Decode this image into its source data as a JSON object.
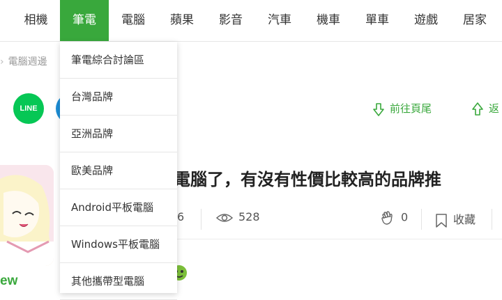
{
  "nav": {
    "items": [
      {
        "label": "相機"
      },
      {
        "label": "筆電"
      },
      {
        "label": "電腦"
      },
      {
        "label": "蘋果"
      },
      {
        "label": "影音"
      },
      {
        "label": "汽車"
      },
      {
        "label": "機車"
      },
      {
        "label": "單車"
      },
      {
        "label": "遊戲"
      },
      {
        "label": "居家"
      }
    ],
    "active_index": 1,
    "accent_color": "#39a83c"
  },
  "dropdown": {
    "items": [
      {
        "label": "筆電綜合討論區"
      },
      {
        "label": "台灣品牌"
      },
      {
        "label": "亞洲品牌"
      },
      {
        "label": "歐美品牌"
      },
      {
        "label": "Android平板電腦"
      },
      {
        "label": "Windows平板電腦"
      },
      {
        "label": "其他攜帶型電腦"
      }
    ]
  },
  "breadcrumb": {
    "label": "電腦週邊"
  },
  "share": {
    "line_label": "LINE",
    "line_color": "#06c755",
    "blue_color": "#1c8ed6"
  },
  "jump": {
    "to_bottom": "前往頁尾",
    "back": "返"
  },
  "post": {
    "title": "提電腦了，有沒有性價比較高的品牌推",
    "author": "ew",
    "count_partial": "6",
    "views": "528",
    "likes": "0",
    "bookmark_label": "收藏"
  }
}
